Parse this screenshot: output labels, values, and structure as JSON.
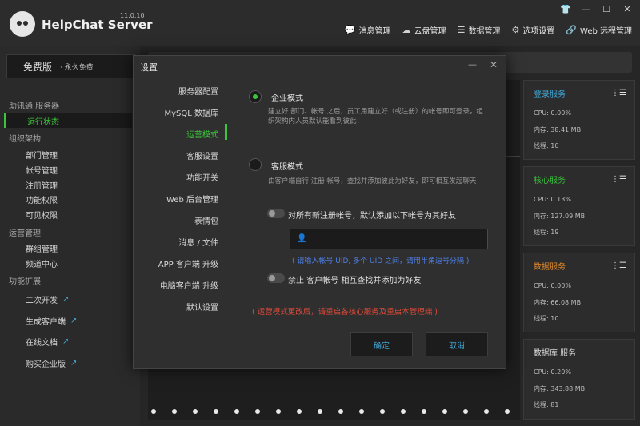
{
  "app": {
    "name": "HelpChat Server",
    "version": "11.0.10"
  },
  "window_controls": {
    "skin": "👕",
    "minimize": "—",
    "maximize": "☐",
    "close": "✕"
  },
  "topnav": [
    {
      "label": "消息管理",
      "icon": "chat-bubble-icon",
      "glyph": "💬"
    },
    {
      "label": "云盘管理",
      "icon": "cloud-icon",
      "glyph": "☁"
    },
    {
      "label": "数据管理",
      "icon": "database-icon",
      "glyph": "☰"
    },
    {
      "label": "选项设置",
      "icon": "gear-icon",
      "glyph": "⚙"
    },
    {
      "label": "Web 远程管理",
      "icon": "link-icon",
      "glyph": "🔗"
    }
  ],
  "sidebar": {
    "edition": "免费版",
    "edition_note": "· 永久免费",
    "groups": [
      {
        "label": "助讯通 服务器",
        "items": [
          "运行状态"
        ]
      },
      {
        "label": "组织架构",
        "items": [
          "部门管理",
          "帐号管理",
          "注册管理",
          "功能权限",
          "可见权限"
        ]
      },
      {
        "label": "运营管理",
        "items": [
          "群组管理",
          "频道中心"
        ]
      },
      {
        "label": "功能扩展",
        "items": [
          "二次开发",
          "生成客户端",
          "在线文档",
          "购买企业版"
        ]
      }
    ],
    "active_item": "运行状态"
  },
  "cards": [
    {
      "title": "登录服务",
      "title_color": "#3fa7d6",
      "cpu": "CPU: 0.00%",
      "mem": "内存: 38.41 MB",
      "threads": "线程: 10",
      "menu": "⋮☰"
    },
    {
      "title": "核心服务",
      "title_color": "#3cc43c",
      "cpu": "CPU: 0.13%",
      "mem": "内存: 127.09 MB",
      "threads": "线程: 19",
      "menu": "⋮☰"
    },
    {
      "title": "数据服务",
      "title_color": "#e0892b",
      "cpu": "CPU: 0.00%",
      "mem": "内存: 66.08 MB",
      "threads": "线程: 10",
      "menu": "⋮☰"
    },
    {
      "title": "数据库 服务",
      "title_color": "#d8d8d8",
      "cpu": "CPU: 0.20%",
      "mem": "内存: 343.88 MB",
      "threads": "线程: 81",
      "menu": "⋮☰"
    }
  ],
  "dialog": {
    "title": "设置",
    "minimize": "—",
    "close": "✕",
    "nav": [
      "服务器配置",
      "MySQL 数据库",
      "运营模式",
      "客服设置",
      "功能开关",
      "Web 后台管理",
      "表情包",
      "消息 / 文件",
      "APP 客户端 升级",
      "电脑客户端 升级",
      "默认设置"
    ],
    "active_nav": "运营模式",
    "enterprise": {
      "label": "企业模式",
      "selected": true,
      "desc": "建立好 部门、帐号 之后，员工用建立好（或注册）的帐号即可登录，组织架构内人员默认能看到彼此！"
    },
    "service": {
      "label": "客服模式",
      "selected": false,
      "desc": "由客户端自行 注册 帐号，查找并添加彼此为好友，即可相互发起聊天！"
    },
    "toggle_auto_friend": {
      "label": "对所有新注册帐号，默认添加以下帐号为其好友",
      "on": false
    },
    "uid_input": {
      "value": "",
      "placeholder": ""
    },
    "uid_hint": "( 请输入帐号 UID, 多个 UID 之间，请用半角逗号分隔 )",
    "toggle_forbid": {
      "label": "禁止 客户帐号 相互查找并添加为好友",
      "on": false
    },
    "warning": "( 运营模式更改后，请重启各核心服务及重启本管理端 )",
    "confirm": "确定",
    "cancel": "取消"
  }
}
